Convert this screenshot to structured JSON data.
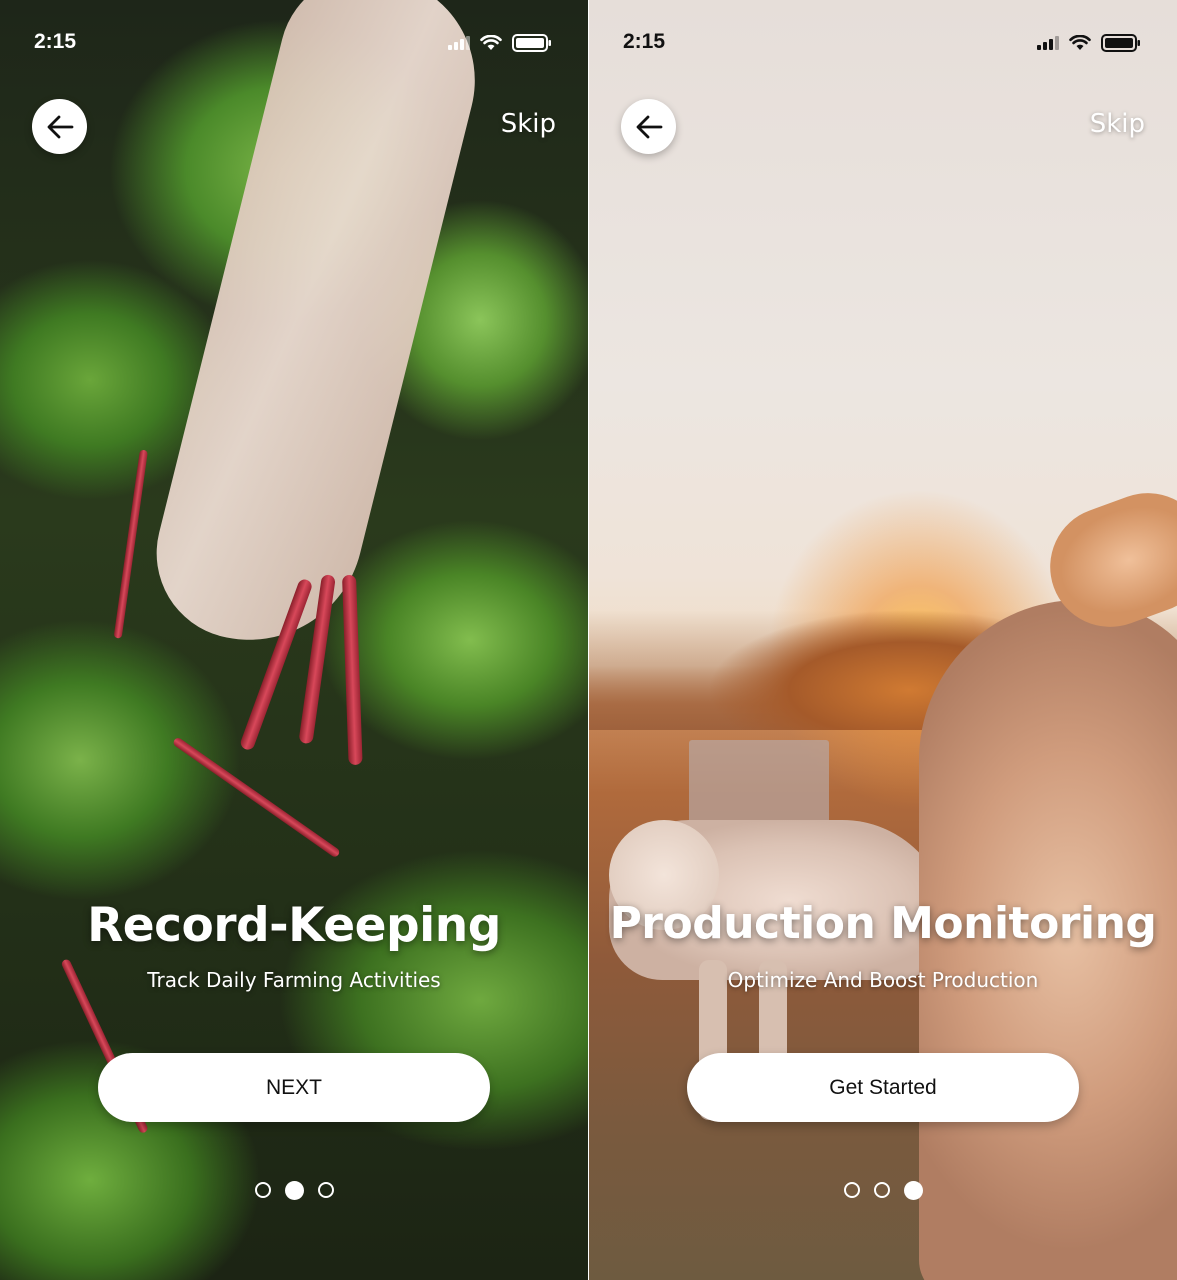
{
  "screens": [
    {
      "status": {
        "time": "2:15"
      },
      "skip_label": "Skip",
      "title": "Record-Keeping",
      "subtitle": "Track Daily Farming Activities",
      "cta_label": "NEXT",
      "pagination": {
        "total": 3,
        "active": 2
      }
    },
    {
      "status": {
        "time": "2:15"
      },
      "skip_label": "Skip",
      "title": "Production Monitoring",
      "subtitle": "Optimize And Boost Production",
      "cta_label": "Get Started",
      "pagination": {
        "total": 3,
        "active": 3
      }
    }
  ],
  "icons": {
    "back": "arrow-left-icon",
    "signal": "cellular-signal-icon",
    "wifi": "wifi-icon",
    "battery": "battery-icon"
  },
  "colors": {
    "button_bg": "#ffffff",
    "button_text": "#111111",
    "overlay_text": "#ffffff"
  }
}
